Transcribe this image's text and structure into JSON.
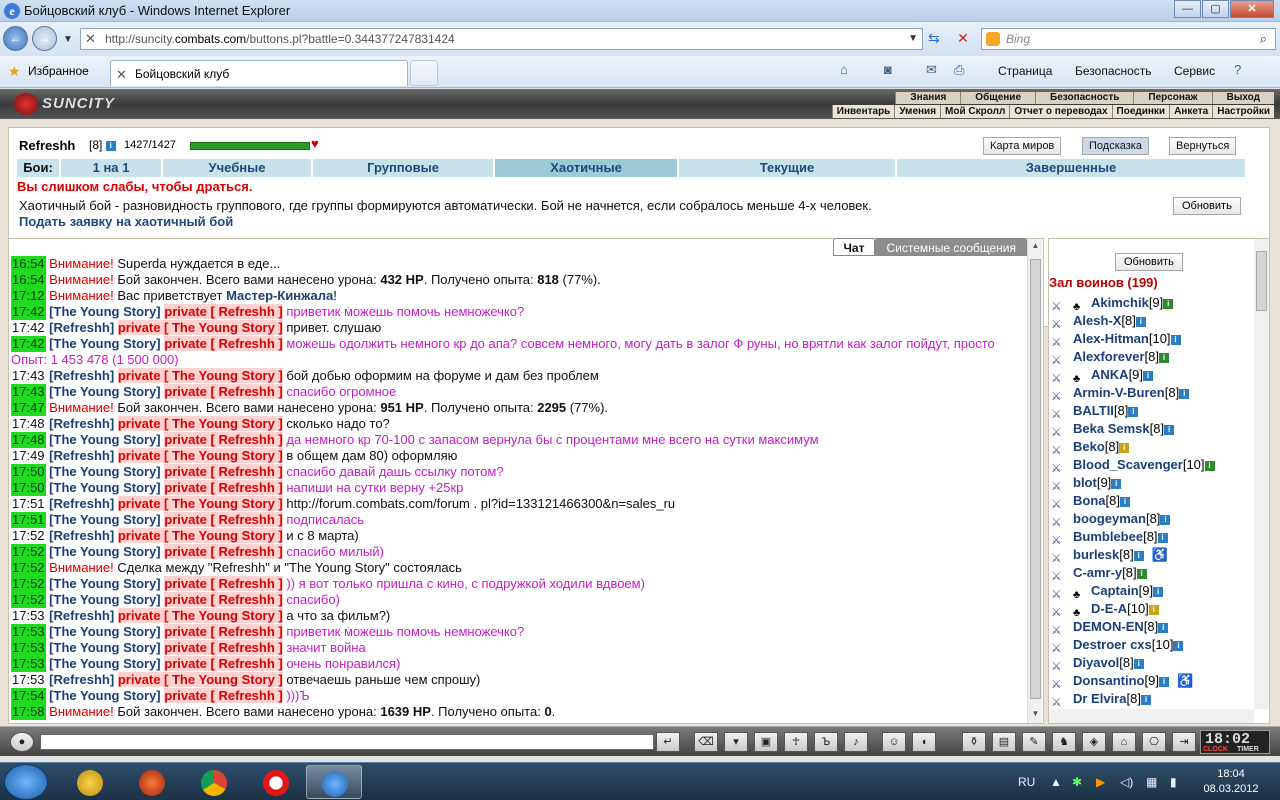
{
  "window": {
    "title": "Бойцовский клуб - Windows Internet Explorer"
  },
  "addr": {
    "url_pre": "http://suncity.",
    "url_host": "combats.com",
    "url_post": "/buttons.pl?battle=0.344377247831424",
    "search_placeholder": "Bing"
  },
  "favbar": {
    "favorites": "Избранное",
    "tab": "Бойцовский клуб",
    "page": "Страница",
    "safety": "Безопасность",
    "service": "Сервис"
  },
  "game": {
    "logo": "SUNCITY",
    "menu1": [
      "Знания",
      "Общение",
      "Безопасность",
      "Персонаж",
      "Выход"
    ],
    "menu2": [
      "Инвентарь",
      "Умения",
      "Мой Скролл",
      "Отчет о переводах",
      "Поединки",
      "Анкета",
      "Настройки"
    ],
    "user": {
      "name": "Refreshh",
      "level": "[8]",
      "hp": "1427/1427",
      "hp_fraction": 1.0
    },
    "top_buttons": [
      "Карта миров",
      "Подсказка",
      "Вернуться"
    ],
    "tabs": {
      "label": "Бои:",
      "items": [
        "1 на 1",
        "Учебные",
        "Групповые",
        "Хаотичные",
        "Текущие",
        "Завершенные"
      ]
    },
    "weak": "Вы слишком слабы, чтобы драться.",
    "desc": "Хаотичный бой - разновидность группового, где группы формируются автоматически. Бой не начнется, если собралось меньше 4-х человек.",
    "apply": "Подать заявку на хаотичный бой",
    "refresh": "Обновить"
  },
  "chat": {
    "tab_chat": "Чат",
    "tab_sys": "Системные сообщения",
    "lines": [
      {
        "t": "16:54",
        "g": true,
        "kind": "alert",
        "a": "Внимание!",
        "m": " Superda нуждается в еде..."
      },
      {
        "t": "16:54",
        "g": true,
        "kind": "alert",
        "a": "Внимание!",
        "m": " Бой закончен. Всего вами нанесено урона: ",
        "b1": "432 HP",
        "m2": ". Получено опыта: ",
        "b2": "818",
        "m3": " (77%)."
      },
      {
        "t": "17:12",
        "g": true,
        "kind": "alert",
        "a": "Внимание!",
        "m": " Вас приветствует ",
        "bl": "Мастер-Кинжала",
        "m2": "!"
      },
      {
        "t": "17:42",
        "g": true,
        "kind": "pm",
        "from": "The Young Story",
        "to": "Refreshh",
        "msg": "приветик можешь помочь немножечко?"
      },
      {
        "t": "17:42",
        "g": false,
        "kind": "pm",
        "from": "Refreshh",
        "to": "The Young Story",
        "msg": "привет. слушаю",
        "black": true
      },
      {
        "t": "17:42",
        "g": true,
        "kind": "pm",
        "from": "The Young Story",
        "to": "Refreshh",
        "msg": "можешь одолжить немного кр до апа? совсем немного, могу дать в залог Ф руны, но врятли как залог пойдут, просто Опыт: 1 453 478 (1 500 000)",
        "wrap": true
      },
      {
        "t": "17:43",
        "g": false,
        "kind": "pm",
        "from": "Refreshh",
        "to": "The Young Story",
        "msg": "бой добью оформим на форуме и дам без проблем",
        "black": true
      },
      {
        "t": "17:43",
        "g": true,
        "kind": "pm",
        "from": "The Young Story",
        "to": "Refreshh",
        "msg": "спасибо огромное"
      },
      {
        "t": "17:47",
        "g": true,
        "kind": "alert",
        "a": "Внимание!",
        "m": " Бой закончен. Всего вами нанесено урона: ",
        "b1": "951 HP",
        "m2": ". Получено опыта: ",
        "b2": "2295",
        "m3": " (77%)."
      },
      {
        "t": "17:48",
        "g": false,
        "kind": "pm",
        "from": "Refreshh",
        "to": "The Young Story",
        "msg": "сколько надо то?",
        "black": true
      },
      {
        "t": "17:48",
        "g": true,
        "kind": "pm",
        "from": "The Young Story",
        "to": "Refreshh",
        "msg": "да немного кр 70-100 с запасом вернула бы с процентами мне всего на сутки максимум"
      },
      {
        "t": "17:49",
        "g": false,
        "kind": "pm",
        "from": "Refreshh",
        "to": "The Young Story",
        "msg": "в общем дам 80) оформляю",
        "black": true
      },
      {
        "t": "17:50",
        "g": true,
        "kind": "pm",
        "from": "The Young Story",
        "to": "Refreshh",
        "msg": "спасибо давай дашь ссылку потом?"
      },
      {
        "t": "17:50",
        "g": true,
        "kind": "pm",
        "from": "The Young Story",
        "to": "Refreshh",
        "msg": "напиши на сутки верну +25кр"
      },
      {
        "t": "17:51",
        "g": false,
        "kind": "pm",
        "from": "Refreshh",
        "to": "The Young Story",
        "msg": "http://forum.combats.com/forum . pl?id=133121466300&n=sales_ru",
        "black": true
      },
      {
        "t": "17:51",
        "g": true,
        "kind": "pm",
        "from": "The Young Story",
        "to": "Refreshh",
        "msg": "подписалась"
      },
      {
        "t": "17:52",
        "g": false,
        "kind": "pm",
        "from": "Refreshh",
        "to": "The Young Story",
        "msg": "и с 8 марта)",
        "black": true
      },
      {
        "t": "17:52",
        "g": true,
        "kind": "pm",
        "from": "The Young Story",
        "to": "Refreshh",
        "msg": "спасибо милый)"
      },
      {
        "t": "17:52",
        "g": true,
        "kind": "alert",
        "a": "Внимание!",
        "m": " Сделка между \"Refreshh\" и \"The Young Story\" состоялась"
      },
      {
        "t": "17:52",
        "g": true,
        "kind": "pm",
        "from": "The Young Story",
        "to": "Refreshh",
        "msg": ")) я вот только пришла с кино, с подружкой ходили вдвоем)"
      },
      {
        "t": "17:52",
        "g": true,
        "kind": "pm",
        "from": "The Young Story",
        "to": "Refreshh",
        "msg": "спасибо)"
      },
      {
        "t": "17:53",
        "g": false,
        "kind": "pm",
        "from": "Refreshh",
        "to": "The Young Story",
        "msg": "а что за фильм?)",
        "black": true
      },
      {
        "t": "17:53",
        "g": true,
        "kind": "pm",
        "from": "The Young Story",
        "to": "Refreshh",
        "msg": "приветик можешь помочь немножечко?"
      },
      {
        "t": "17:53",
        "g": true,
        "kind": "pm",
        "from": "The Young Story",
        "to": "Refreshh",
        "msg": "значит война"
      },
      {
        "t": "17:53",
        "g": true,
        "kind": "pm",
        "from": "The Young Story",
        "to": "Refreshh",
        "msg": "очень понравился)"
      },
      {
        "t": "17:53",
        "g": false,
        "kind": "pm",
        "from": "Refreshh",
        "to": "The Young Story",
        "msg": "отвечаешь раньше чем спрошу)",
        "black": true
      },
      {
        "t": "17:54",
        "g": true,
        "kind": "pm",
        "from": "The Young Story",
        "to": "Refreshh",
        "msg": ")))Ъ"
      },
      {
        "t": "17:58",
        "g": true,
        "kind": "alert",
        "a": "Внимание!",
        "m": " Бой закончен. Всего вами нанесено урона: ",
        "b1": "1639 HP",
        "m2": ". Получено опыта: ",
        "b2": "0",
        "m3": "."
      }
    ]
  },
  "users": {
    "refresh": "Обновить",
    "hall": "Зал воинов (199)",
    "list": [
      {
        "n": "Akimchik",
        "l": "[9]",
        "c": "green",
        "clan": true
      },
      {
        "n": "Alesh-X",
        "l": "[8]",
        "c": "blue"
      },
      {
        "n": "Alex-Hitman",
        "l": "[10]",
        "c": "blue"
      },
      {
        "n": "Alexforever",
        "l": "[8]",
        "c": "green"
      },
      {
        "n": "ANKA",
        "l": "[9]",
        "c": "blue",
        "clan": true
      },
      {
        "n": "Armin-V-Buren",
        "l": "[8]",
        "c": "blue"
      },
      {
        "n": "BALTII",
        "l": "[8]",
        "c": "blue"
      },
      {
        "n": "Beka Semsk",
        "l": "[8]",
        "c": "blue"
      },
      {
        "n": "Beko",
        "l": "[8]",
        "c": "yellow"
      },
      {
        "n": "Blood_Scavenger",
        "l": "[10]",
        "c": "green"
      },
      {
        "n": "blot",
        "l": "[9]",
        "c": "blue"
      },
      {
        "n": "Bona",
        "l": "[8]",
        "c": "blue"
      },
      {
        "n": "boogeyman",
        "l": "[8]",
        "c": "blue"
      },
      {
        "n": "Bumblebee",
        "l": "[8]",
        "c": "blue"
      },
      {
        "n": "burlesk",
        "l": "[8]",
        "c": "blue",
        "extra": true
      },
      {
        "n": "C-amr-y",
        "l": "[8]",
        "c": "green"
      },
      {
        "n": "Captain",
        "l": "[9]",
        "c": "blue",
        "clan": true
      },
      {
        "n": "D-E-A",
        "l": "[10]",
        "c": "yellow",
        "clan": true
      },
      {
        "n": "DEMON-EN",
        "l": "[8]",
        "c": "blue"
      },
      {
        "n": "Destroer cxs",
        "l": "[10]",
        "c": "blue"
      },
      {
        "n": "Diyavol",
        "l": "[8]",
        "c": "blue"
      },
      {
        "n": "Donsantino",
        "l": "[9]",
        "c": "blue",
        "extra": true
      },
      {
        "n": "Dr Elvira",
        "l": "[8]",
        "c": "blue"
      }
    ]
  },
  "clock": {
    "time": "18:02",
    "clk": "CLOCK",
    "timer": "TIMER"
  },
  "taskbar": {
    "lang": "RU",
    "time": "18:04",
    "date": "08.03.2012"
  }
}
